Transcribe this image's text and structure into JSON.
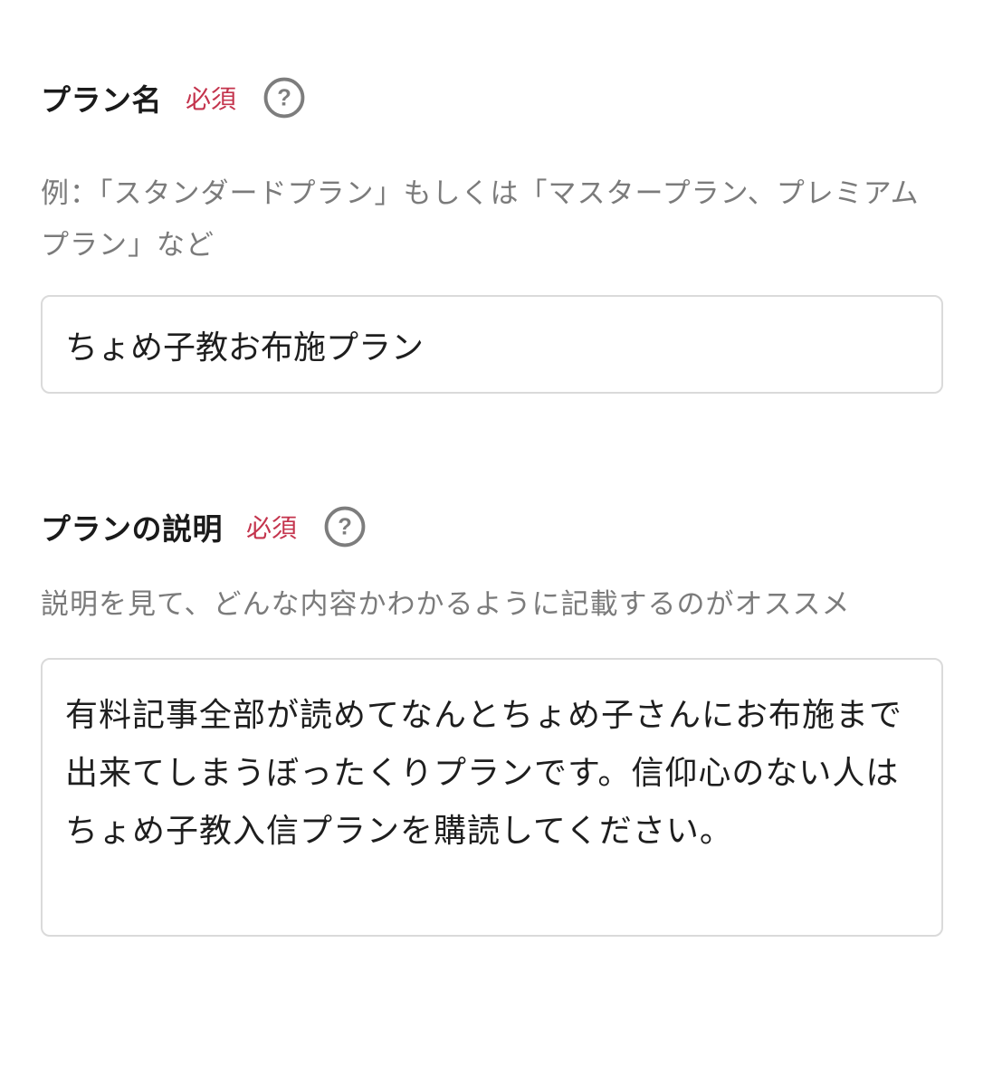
{
  "plan_name": {
    "label": "プラン名",
    "required": "必須",
    "hint": "例：「スタンダードプラン」もしくは「マスタープラン、プレミアムプラン」など",
    "value": "ちょめ子教お布施プラン"
  },
  "plan_description": {
    "label": "プランの説明",
    "required": "必須",
    "hint": "説明を見て、どんな内容かわかるように記載するのがオススメ",
    "value": "有料記事全部が読めてなんとちょめ子さんにお布施まで出来てしまうぼったくりプランです。信仰心のない人はちょめ子教入信プランを購読してください。"
  },
  "colors": {
    "required": "#c4344d",
    "hint_text": "#7b7b7b",
    "border": "#dadada",
    "help_icon": "#7d7d7d"
  },
  "icons": {
    "help": "question-circle-icon"
  }
}
